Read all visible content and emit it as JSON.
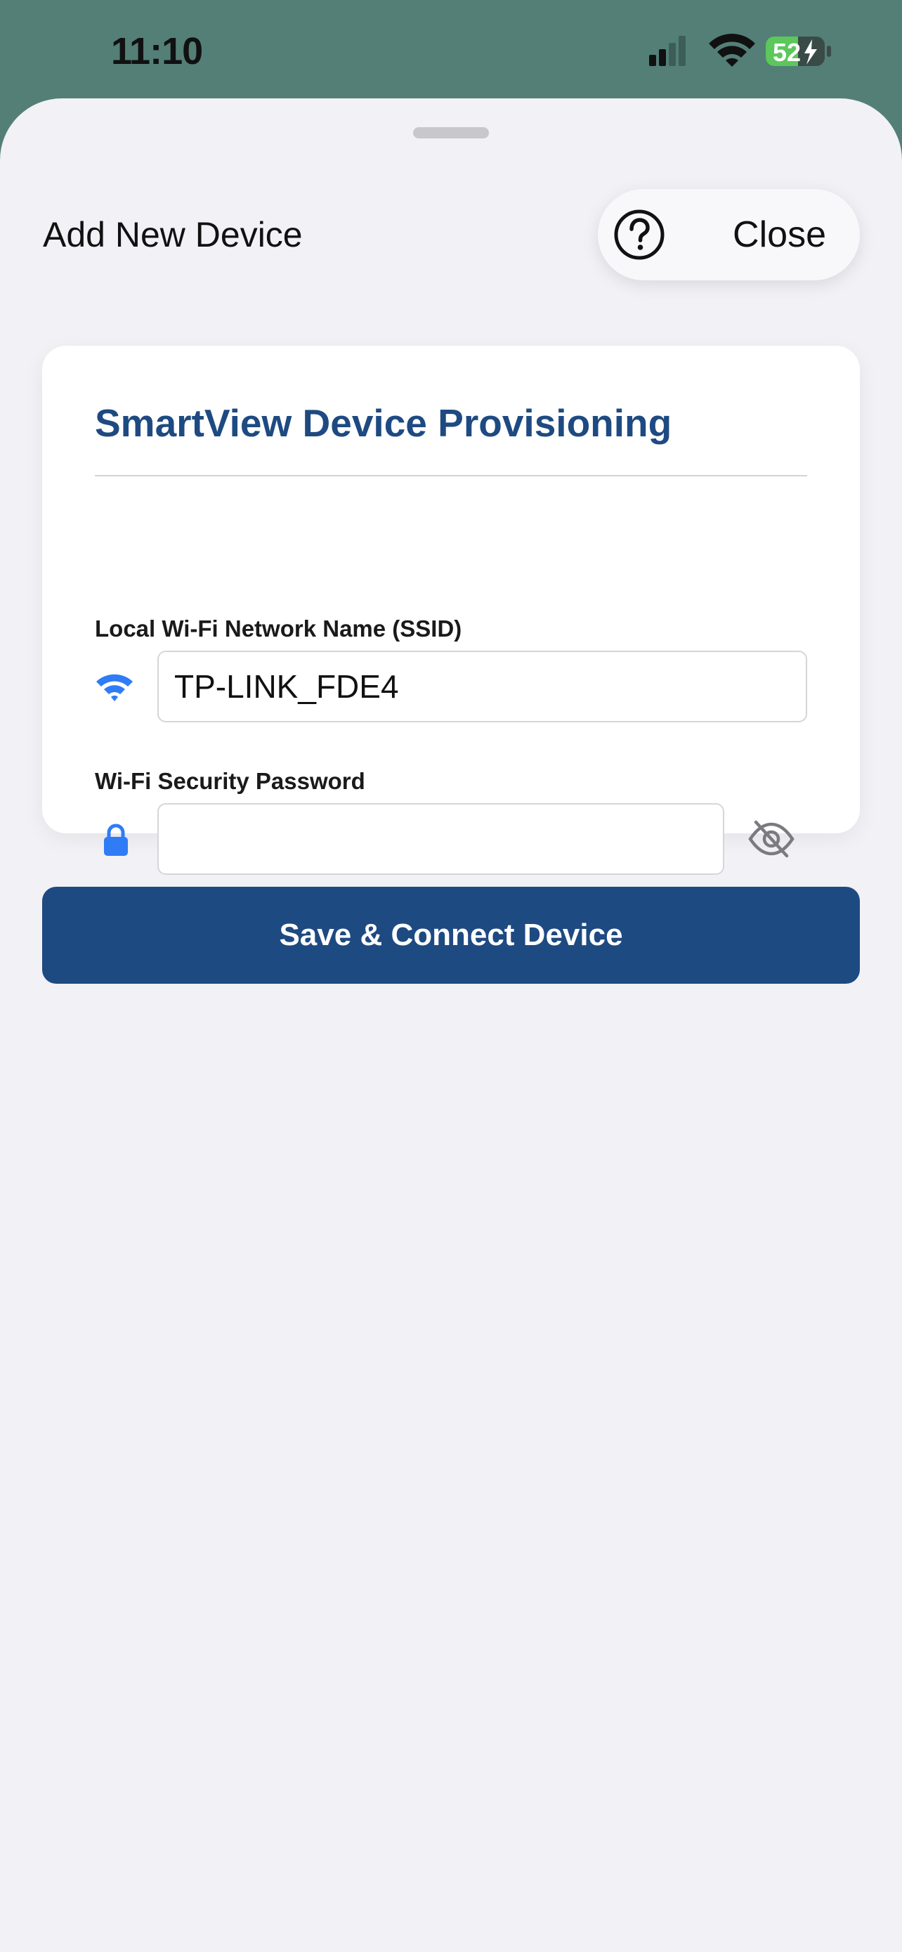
{
  "status_bar": {
    "time": "11:10",
    "battery": "52",
    "icons": [
      "signal-icon",
      "wifi-icon",
      "battery-charging-icon"
    ]
  },
  "sheet": {
    "title": "Add New Device",
    "help_icon": "help-circle-icon",
    "close_label": "Close"
  },
  "form": {
    "heading": "SmartView Device Provisioning",
    "ssid": {
      "label": "Local Wi-Fi Network Name (SSID)",
      "value": "TP-LINK_FDE4",
      "icon": "wifi-icon"
    },
    "password": {
      "label": "Wi-Fi Security Password",
      "value": "",
      "icon": "lock-icon",
      "toggle_icon": "eye-slash-icon"
    }
  },
  "actions": {
    "submit_label": "Save & Connect Device"
  },
  "colors": {
    "accent": "#1e4a82",
    "icon_blue": "#2f7cf6",
    "status_bg": "#537f77",
    "sheet_bg": "#f1f1f6",
    "battery_green": "#5cc75a"
  }
}
